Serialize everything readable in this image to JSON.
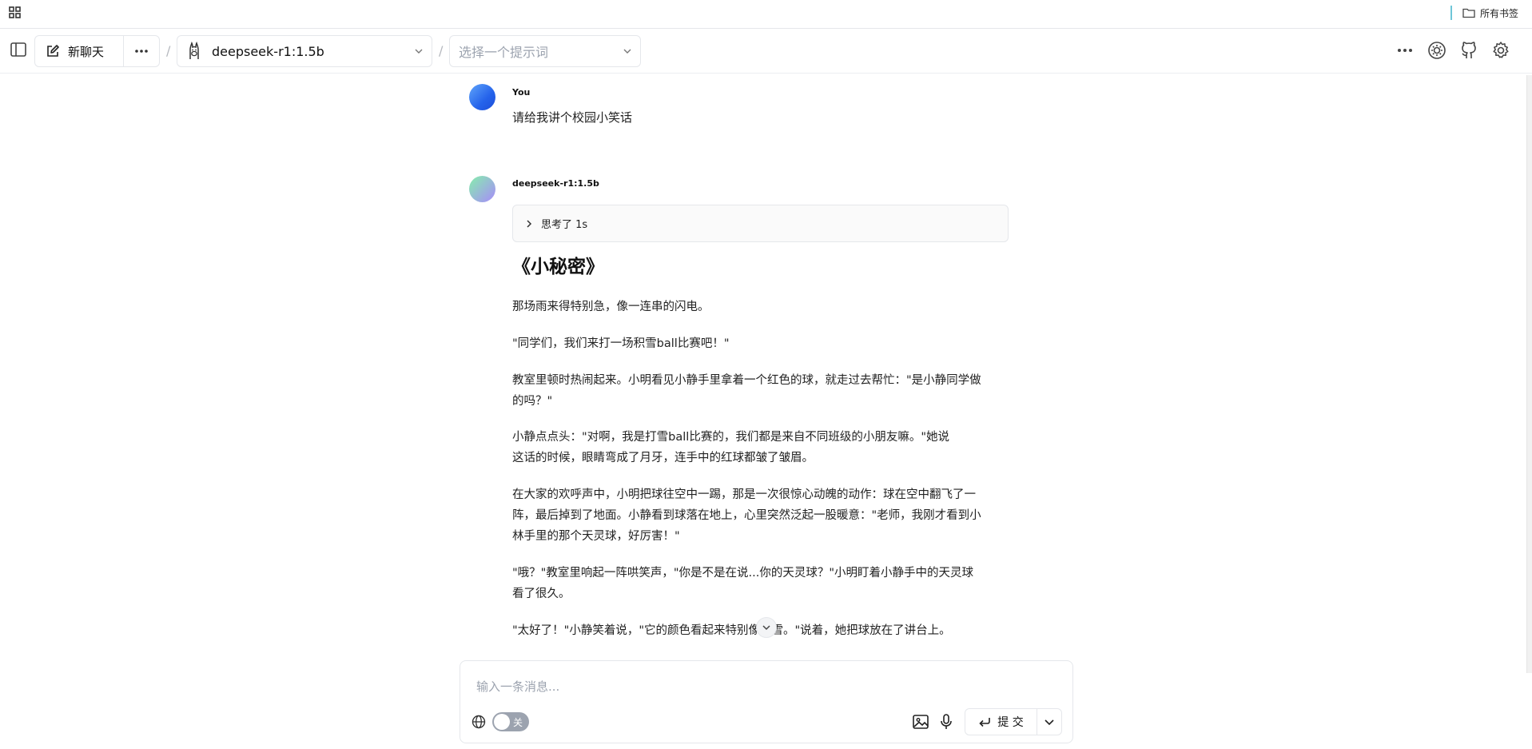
{
  "bookmarks_bar": {
    "folder_label": "所有书签"
  },
  "toolbar": {
    "new_chat_label": "新聊天",
    "model_label": "deepseek-r1:1.5b",
    "prompt_placeholder": "选择一个提示词",
    "separator": "/"
  },
  "messages": {
    "user": {
      "sender": "You",
      "text": "请给我讲个校园小笑话"
    },
    "assistant": {
      "sender": "deepseek-r1:1.5b",
      "thinking_label": "思考了 1s",
      "title": "《小秘密》",
      "paragraphs": [
        "那场雨来得特别急，像一连串的闪电。",
        "\"同学们，我们来打一场积雪ball比赛吧！\"",
        "教室里顿时热闹起来。小明看见小静手里拿着一个红色的球，就走过去帮忙：\"是小静同学做的吗？\"",
        "小静点点头：\"对啊，我是打雪ball比赛的，我们都是来自不同班级的小朋友嘛。\"她说这话的时候，眼睛弯成了月牙，连手中的红球都皱了皱眉。",
        "在大家的欢呼声中，小明把球往空中一踢，那是一次很惊心动魄的动作：球在空中翻飞了一阵，最后掉到了地面。小静看到球落在地上，心里突然泛起一股暖意：\"老师，我刚才看到小林手里的那个天灵球，好厉害！\"",
        "\"哦？\"教室里响起一阵哄笑声，\"你是不是在说...你的天灵球？\"小明盯着小静手中的天灵球看了很久。",
        "\"太好了！\"小静笑着说，\"它的颜色看起来特别像绿雪。\"说着，她把球放在了讲台上。"
      ]
    }
  },
  "composer": {
    "placeholder": "输入一条消息...",
    "web_search_toggle_label": "关",
    "web_search_enabled": false,
    "submit_label": "提 交"
  },
  "colors": {
    "user_avatar": "#2563eb",
    "toggle_off": "#9ca3af",
    "border": "#e5e7eb"
  }
}
